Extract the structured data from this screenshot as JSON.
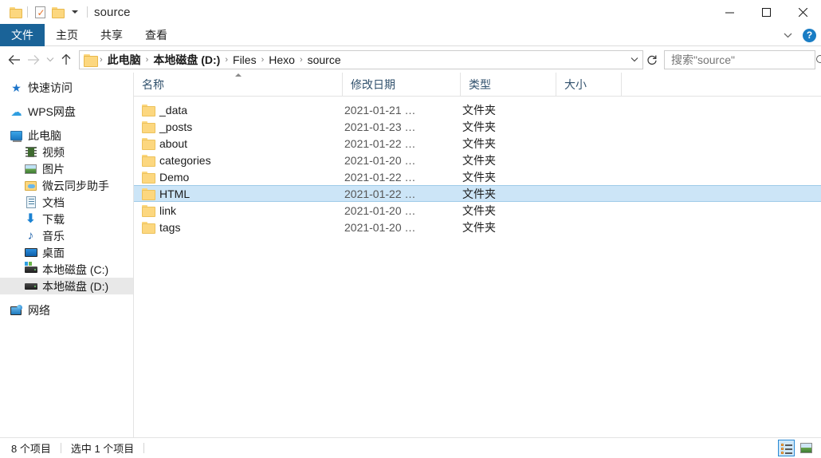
{
  "window": {
    "title": "source",
    "quick_access": [
      {
        "icon": "folder-icon",
        "name": "qat-folder"
      },
      {
        "icon": "properties-checkmark-icon",
        "name": "qat-properties"
      },
      {
        "icon": "new-folder-icon",
        "name": "qat-new-folder"
      },
      {
        "icon": "chevron-down-icon",
        "name": "qat-customize"
      }
    ],
    "controls": {
      "minimize": "minimize-icon",
      "maximize": "maximize-icon",
      "close": "close-icon"
    }
  },
  "ribbon": {
    "tabs": [
      {
        "label": "文件",
        "active": true
      },
      {
        "label": "主页",
        "active": false
      },
      {
        "label": "共享",
        "active": false
      },
      {
        "label": "查看",
        "active": false
      }
    ],
    "expand_icon": "chevron-down-icon",
    "help_label": "?"
  },
  "address": {
    "back_icon": "arrow-left-icon",
    "forward_icon": "arrow-right-icon",
    "history_icon": "chevron-down-icon",
    "up_icon": "arrow-up-icon",
    "refresh_icon": "refresh-icon",
    "dropdown_icon": "chevron-down-icon",
    "breadcrumbs": [
      {
        "label": "此电脑",
        "bold": true
      },
      {
        "label": "本地磁盘 (D:)",
        "bold": true
      },
      {
        "label": "Files",
        "bold": false
      },
      {
        "label": "Hexo",
        "bold": false
      },
      {
        "label": "source",
        "bold": false
      }
    ],
    "separator": "›"
  },
  "search": {
    "value": "搜索\"source\"",
    "placeholder": "搜索\"source\"",
    "icon": "search-icon"
  },
  "sidebar": {
    "items": [
      {
        "label": "快速访问",
        "icon": "star-icon",
        "level": 1,
        "selected": false,
        "gap_before": false
      },
      {
        "label": "WPS网盘",
        "icon": "cloud-icon",
        "level": 1,
        "selected": false,
        "gap_before": true
      },
      {
        "label": "此电脑",
        "icon": "this-pc-icon",
        "level": 1,
        "selected": false,
        "gap_before": true
      },
      {
        "label": "视频",
        "icon": "video-icon",
        "level": 2,
        "selected": false,
        "gap_before": false
      },
      {
        "label": "图片",
        "icon": "pictures-icon",
        "level": 2,
        "selected": false,
        "gap_before": false
      },
      {
        "label": "微云同步助手",
        "icon": "weiyun-folder-icon",
        "level": 2,
        "selected": false,
        "gap_before": false
      },
      {
        "label": "文档",
        "icon": "documents-icon",
        "level": 2,
        "selected": false,
        "gap_before": false
      },
      {
        "label": "下载",
        "icon": "download-icon",
        "level": 2,
        "selected": false,
        "gap_before": false
      },
      {
        "label": "音乐",
        "icon": "music-icon",
        "level": 2,
        "selected": false,
        "gap_before": false
      },
      {
        "label": "桌面",
        "icon": "desktop-icon",
        "level": 2,
        "selected": false,
        "gap_before": false
      },
      {
        "label": "本地磁盘 (C:)",
        "icon": "system-drive-icon",
        "level": 2,
        "selected": false,
        "gap_before": false
      },
      {
        "label": "本地磁盘 (D:)",
        "icon": "drive-icon",
        "level": 2,
        "selected": true,
        "gap_before": false
      },
      {
        "label": "网络",
        "icon": "network-icon",
        "level": 1,
        "selected": false,
        "gap_before": true
      }
    ]
  },
  "filelist": {
    "columns": [
      {
        "label": "名称",
        "sorted": true,
        "sort_direction": "asc"
      },
      {
        "label": "修改日期",
        "sorted": false
      },
      {
        "label": "类型",
        "sorted": false
      },
      {
        "label": "大小",
        "sorted": false
      }
    ],
    "rows": [
      {
        "name": "_data",
        "date": "2021-01-21 …",
        "type": "文件夹",
        "size": "",
        "selected": false
      },
      {
        "name": "_posts",
        "date": "2021-01-23 …",
        "type": "文件夹",
        "size": "",
        "selected": false
      },
      {
        "name": "about",
        "date": "2021-01-22 …",
        "type": "文件夹",
        "size": "",
        "selected": false
      },
      {
        "name": "categories",
        "date": "2021-01-20 …",
        "type": "文件夹",
        "size": "",
        "selected": false
      },
      {
        "name": "Demo",
        "date": "2021-01-22 …",
        "type": "文件夹",
        "size": "",
        "selected": false
      },
      {
        "name": "HTML",
        "date": "2021-01-22 …",
        "type": "文件夹",
        "size": "",
        "selected": true
      },
      {
        "name": "link",
        "date": "2021-01-20 …",
        "type": "文件夹",
        "size": "",
        "selected": false
      },
      {
        "name": "tags",
        "date": "2021-01-20 …",
        "type": "文件夹",
        "size": "",
        "selected": false
      }
    ]
  },
  "status": {
    "item_count": "8 个项目",
    "selection": "选中 1 个项目",
    "view_details_icon": "details-view-icon",
    "view_large_icon": "large-icons-view-icon"
  },
  "colors": {
    "accent_blue": "#1a6398",
    "selection_blue": "#cce5f7",
    "selection_border": "#9fcbe8",
    "folder_yellow": "#fcd77f",
    "header_text": "#31516d",
    "sidebar_selected": "#e8e8e8"
  }
}
